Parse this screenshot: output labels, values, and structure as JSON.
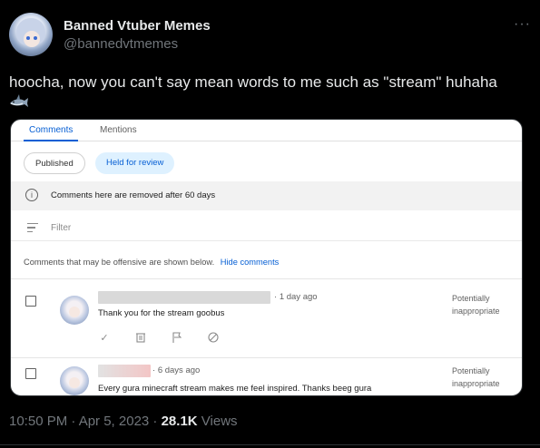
{
  "tweet": {
    "display_name": "Banned Vtuber Memes",
    "handle": "@bannedvtmemes",
    "more_icon": "more-horizontal-icon",
    "text": "hoocha, now you can't say mean words to me such as \"stream\" huhaha",
    "emoji_icon": "shark-icon"
  },
  "screenshot": {
    "tabs": [
      {
        "label": "Comments"
      },
      {
        "label": "Mentions"
      }
    ],
    "chips": [
      {
        "label": "Published"
      },
      {
        "label": "Held for review"
      }
    ],
    "info": {
      "icon": "info-icon",
      "text": "Comments here are removed after 60 days"
    },
    "filter": {
      "icon": "filter-icon",
      "placeholder": "Filter"
    },
    "notice": {
      "text": "Comments that may be offensive are shown below.",
      "link": "Hide comments"
    },
    "comments": [
      {
        "time": "1 day ago",
        "text": "Thank you for the stream goobus",
        "status_line1": "Potentially",
        "status_line2": "inappropriate",
        "actions": [
          "check-icon",
          "delete-icon",
          "flag-icon",
          "block-icon"
        ]
      },
      {
        "time": "6 days ago",
        "text": "Every gura minecraft stream makes me feel inspired. Thanks beeg gura",
        "status_line1": "Potentially",
        "status_line2": "inappropriate"
      }
    ]
  },
  "meta": {
    "timestamp": "10:50 PM · Apr 5, 2023 · ",
    "views_count": "28.1K",
    "views_label": " Views"
  }
}
